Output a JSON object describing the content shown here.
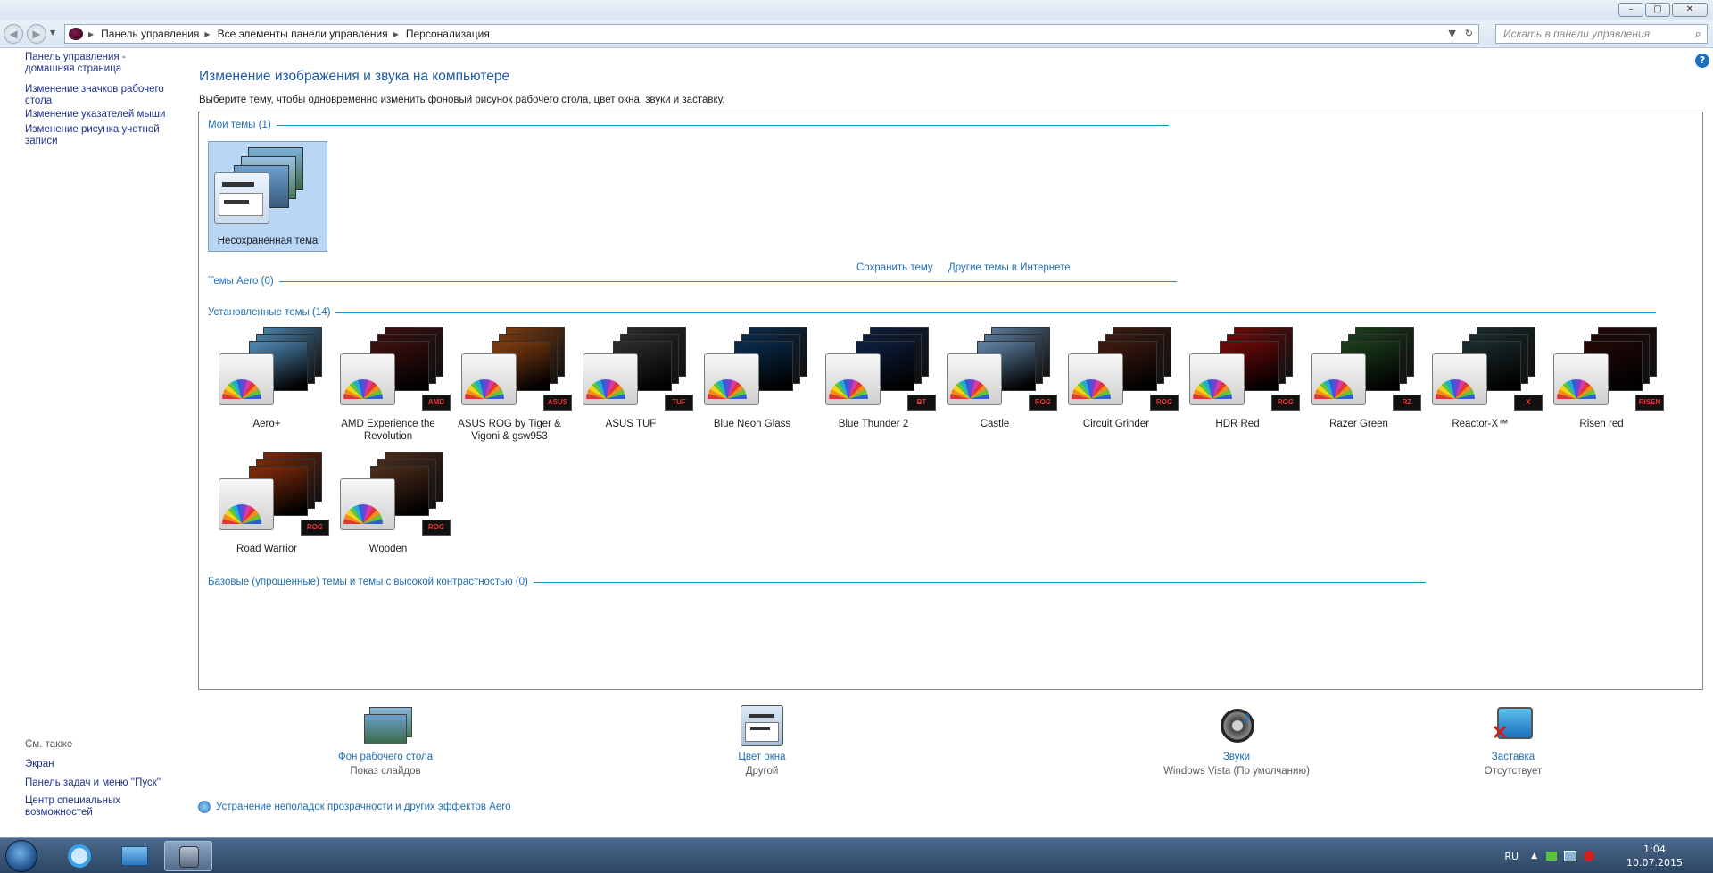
{
  "window": {
    "min": "–",
    "max": "□",
    "close": "✕"
  },
  "nav": {
    "back": "◀",
    "forward": "▶",
    "refresh": "↻",
    "dropdown": "▼"
  },
  "breadcrumbs": [
    "Панель управления",
    "Все элементы панели управления",
    "Персонализация"
  ],
  "search": {
    "placeholder": "Искать в панели управления",
    "icon": "⌕"
  },
  "help_icon": "?",
  "left": {
    "links": [
      "Панель управления - домашняя страница",
      "Изменение значков рабочего стола",
      "Изменение указателей мыши",
      "Изменение рисунка учетной записи"
    ],
    "see_also_title": "См. также",
    "see_also": [
      "Экран",
      "Панель задач и меню ''Пуск''",
      "Центр специальных возможностей"
    ]
  },
  "main": {
    "heading": "Изменение изображения и звука на компьютере",
    "subheading": "Выберите тему, чтобы одновременно изменить фоновый рисунок рабочего стола, цвет окна, звуки и заставку.",
    "groups": {
      "my": "Мои темы (1)",
      "aero": "Темы Aero (0)",
      "installed": "Установленные темы (14)",
      "basic": "Базовые (упрощенные) темы и темы с высокой контрастностью (0)"
    },
    "my_theme": "Несохраненная тема",
    "save_theme": "Сохранить тему",
    "online_themes": "Другие темы в Интернете",
    "installed_themes": [
      {
        "name": "Aero+",
        "color": "#4a7fa8",
        "badge": ""
      },
      {
        "name": "AMD Experience the Revolution",
        "color": "#3a1010",
        "badge": "AMD"
      },
      {
        "name": "ASUS ROG by Tiger & Vigoni & gsw953",
        "color": "#7a3a10",
        "badge": "ASUS"
      },
      {
        "name": "ASUS TUF",
        "color": "#2a2a2a",
        "badge": "TUF"
      },
      {
        "name": "Blue Neon Glass",
        "color": "#0a2a4a",
        "badge": ""
      },
      {
        "name": "Blue Thunder 2",
        "color": "#0d1d3a",
        "badge": "BT"
      },
      {
        "name": "Castle",
        "color": "#5a7a9a",
        "badge": "ROG"
      },
      {
        "name": "Circuit Grinder",
        "color": "#3a1a10",
        "badge": "ROG"
      },
      {
        "name": "HDR Red",
        "color": "#6a0a0a",
        "badge": "ROG"
      },
      {
        "name": "Razer Green",
        "color": "#1a3a1a",
        "badge": "RZ"
      },
      {
        "name": "Reactor-X™",
        "color": "#1a2a2a",
        "badge": "X"
      },
      {
        "name": "Risen red",
        "color": "#200808",
        "badge": "RISEN"
      },
      {
        "name": "Road Warrior",
        "color": "#7a2a0a",
        "badge": "ROG"
      },
      {
        "name": "Wooden",
        "color": "#4a2a1a",
        "badge": "ROG"
      }
    ]
  },
  "bottom": {
    "items": [
      {
        "label": "Фон рабочего стола",
        "sub": "Показ слайдов"
      },
      {
        "label": "Цвет окна",
        "sub": "Другой"
      },
      {
        "label": "Звуки",
        "sub": "Windows Vista (По умолчанию)"
      },
      {
        "label": "Заставка",
        "sub": "Отсутствует"
      }
    ],
    "troubleshoot": "Устранение неполадок прозрачности и других эффектов Aero"
  },
  "taskbar": {
    "lang": "RU",
    "time": "1:04",
    "date": "10.07.2015"
  },
  "colors": {
    "accent": "#1e6eb4",
    "heading": "#1e5aa8",
    "link": "#1e3287",
    "taskbar": "#2b4563"
  }
}
